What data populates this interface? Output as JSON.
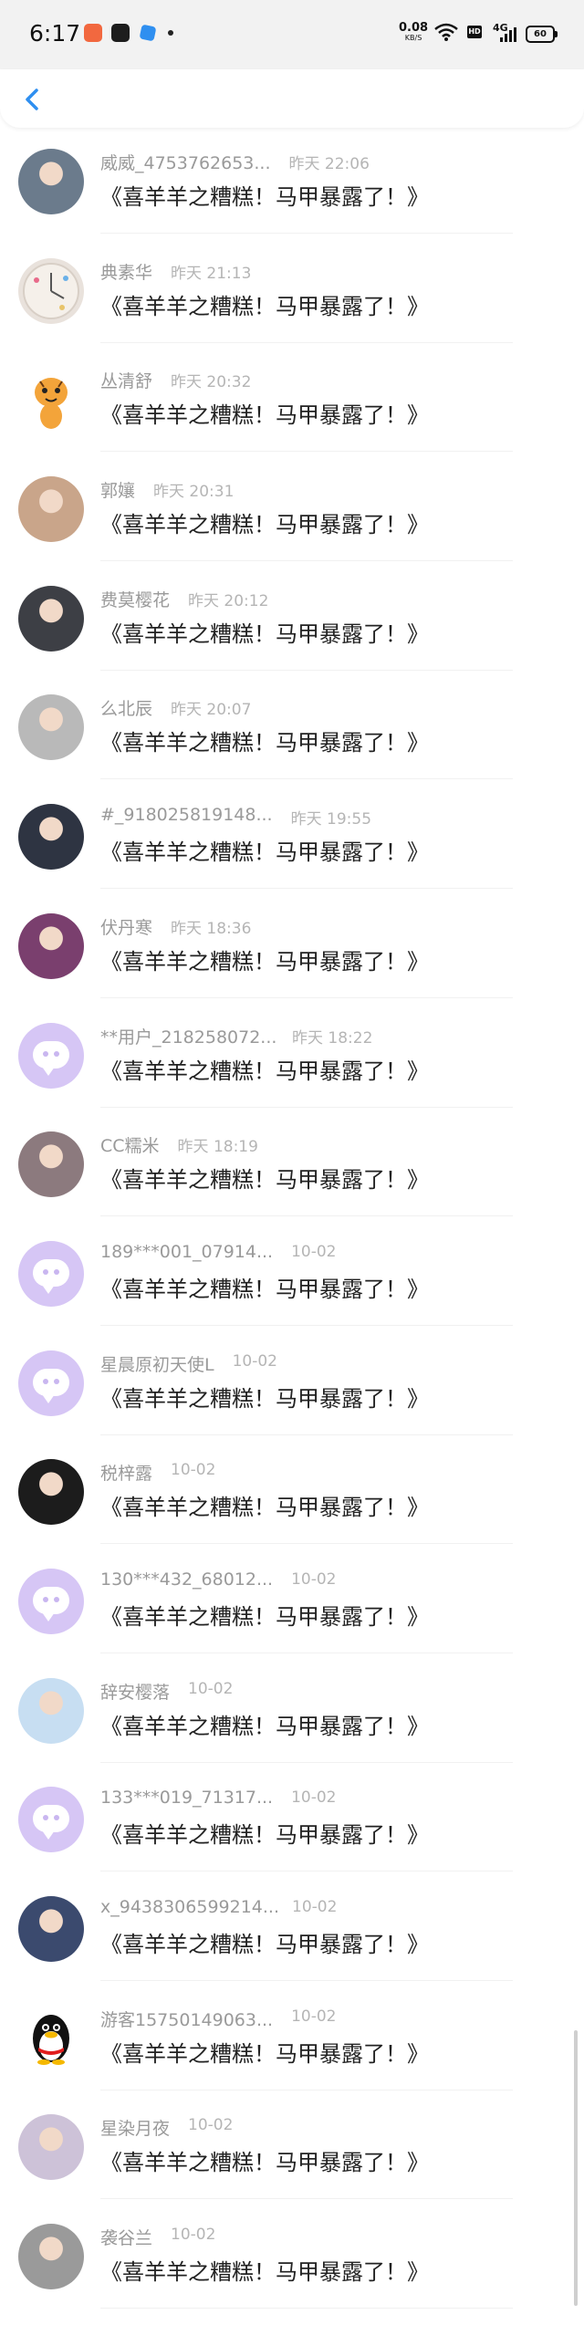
{
  "status_bar": {
    "time": "6:17",
    "speed_value": "0.08",
    "speed_unit": "KB/S",
    "hd": "HD",
    "network": "4G",
    "battery": "60"
  },
  "nav": {
    "back_icon": "chevron-left-icon",
    "accent": "#2f8ff0"
  },
  "comments": [
    {
      "name": "威威_4753762653...",
      "time": "昨天 22:06",
      "text": "《喜羊羊之糟糕！马甲暴露了！》",
      "avatar": "photo",
      "color": "#6b7b8c"
    },
    {
      "name": "典素华",
      "time": "昨天 21:13",
      "text": "《喜羊羊之糟糕！马甲暴露了！》",
      "avatar": "clock",
      "color": "#e9e2dc"
    },
    {
      "name": "丛清舒",
      "time": "昨天 20:32",
      "text": "《喜羊羊之糟糕！马甲暴露了！》",
      "avatar": "tiger",
      "color": "#f3a43a"
    },
    {
      "name": "郭孃",
      "time": "昨天 20:31",
      "text": "《喜羊羊之糟糕！马甲暴露了！》",
      "avatar": "photo",
      "color": "#c9a58a"
    },
    {
      "name": "费莫樱花",
      "time": "昨天 20:12",
      "text": "《喜羊羊之糟糕！马甲暴露了！》",
      "avatar": "photo",
      "color": "#3d3f45"
    },
    {
      "name": "么北辰",
      "time": "昨天 20:07",
      "text": "《喜羊羊之糟糕！马甲暴露了！》",
      "avatar": "photo",
      "color": "#b9b9b9"
    },
    {
      "name": "#_918025819148...",
      "time": "昨天 19:55",
      "text": "《喜羊羊之糟糕！马甲暴露了！》",
      "avatar": "photo",
      "color": "#2e3442"
    },
    {
      "name": "伏丹寒",
      "time": "昨天 18:36",
      "text": "《喜羊羊之糟糕！马甲暴露了！》",
      "avatar": "photo",
      "color": "#7a3f6e"
    },
    {
      "name": "**用户_218258072...",
      "time": "昨天 18:22",
      "text": "《喜羊羊之糟糕！马甲暴露了！》",
      "avatar": "default",
      "color": "#d6c6f5"
    },
    {
      "name": "CC糯米",
      "time": "昨天 18:19",
      "text": "《喜羊羊之糟糕！马甲暴露了！》",
      "avatar": "photo",
      "color": "#8c7a7e"
    },
    {
      "name": "189***001_07914...",
      "time": "10-02",
      "text": "《喜羊羊之糟糕！马甲暴露了！》",
      "avatar": "default",
      "color": "#d6c6f5"
    },
    {
      "name": "星晨原初天使L",
      "time": "10-02",
      "text": "《喜羊羊之糟糕！马甲暴露了！》",
      "avatar": "default",
      "color": "#d6c6f5"
    },
    {
      "name": "税梓露",
      "time": "10-02",
      "text": "《喜羊羊之糟糕！马甲暴露了！》",
      "avatar": "photo",
      "color": "#1c1c1c"
    },
    {
      "name": "130***432_68012...",
      "time": "10-02",
      "text": "《喜羊羊之糟糕！马甲暴露了！》",
      "avatar": "default",
      "color": "#d6c6f5"
    },
    {
      "name": "辞安樱落",
      "time": "10-02",
      "text": "《喜羊羊之糟糕！马甲暴露了！》",
      "avatar": "photo",
      "color": "#c7def2"
    },
    {
      "name": "133***019_71317...",
      "time": "10-02",
      "text": "《喜羊羊之糟糕！马甲暴露了！》",
      "avatar": "default",
      "color": "#d6c6f5"
    },
    {
      "name": "x_9438306599214...",
      "time": "10-02",
      "text": "《喜羊羊之糟糕！马甲暴露了！》",
      "avatar": "photo",
      "color": "#3b4a6e"
    },
    {
      "name": "游客15750149063...",
      "time": "10-02",
      "text": "《喜羊羊之糟糕！马甲暴露了！》",
      "avatar": "penguin",
      "color": "#ffffff"
    },
    {
      "name": "星染月夜",
      "time": "10-02",
      "text": "《喜羊羊之糟糕！马甲暴露了！》",
      "avatar": "photo",
      "color": "#cdc2d8"
    },
    {
      "name": "袭谷兰",
      "time": "10-02",
      "text": "《喜羊羊之糟糕！马甲暴露了！》",
      "avatar": "photo",
      "color": "#9a9a9a"
    }
  ]
}
